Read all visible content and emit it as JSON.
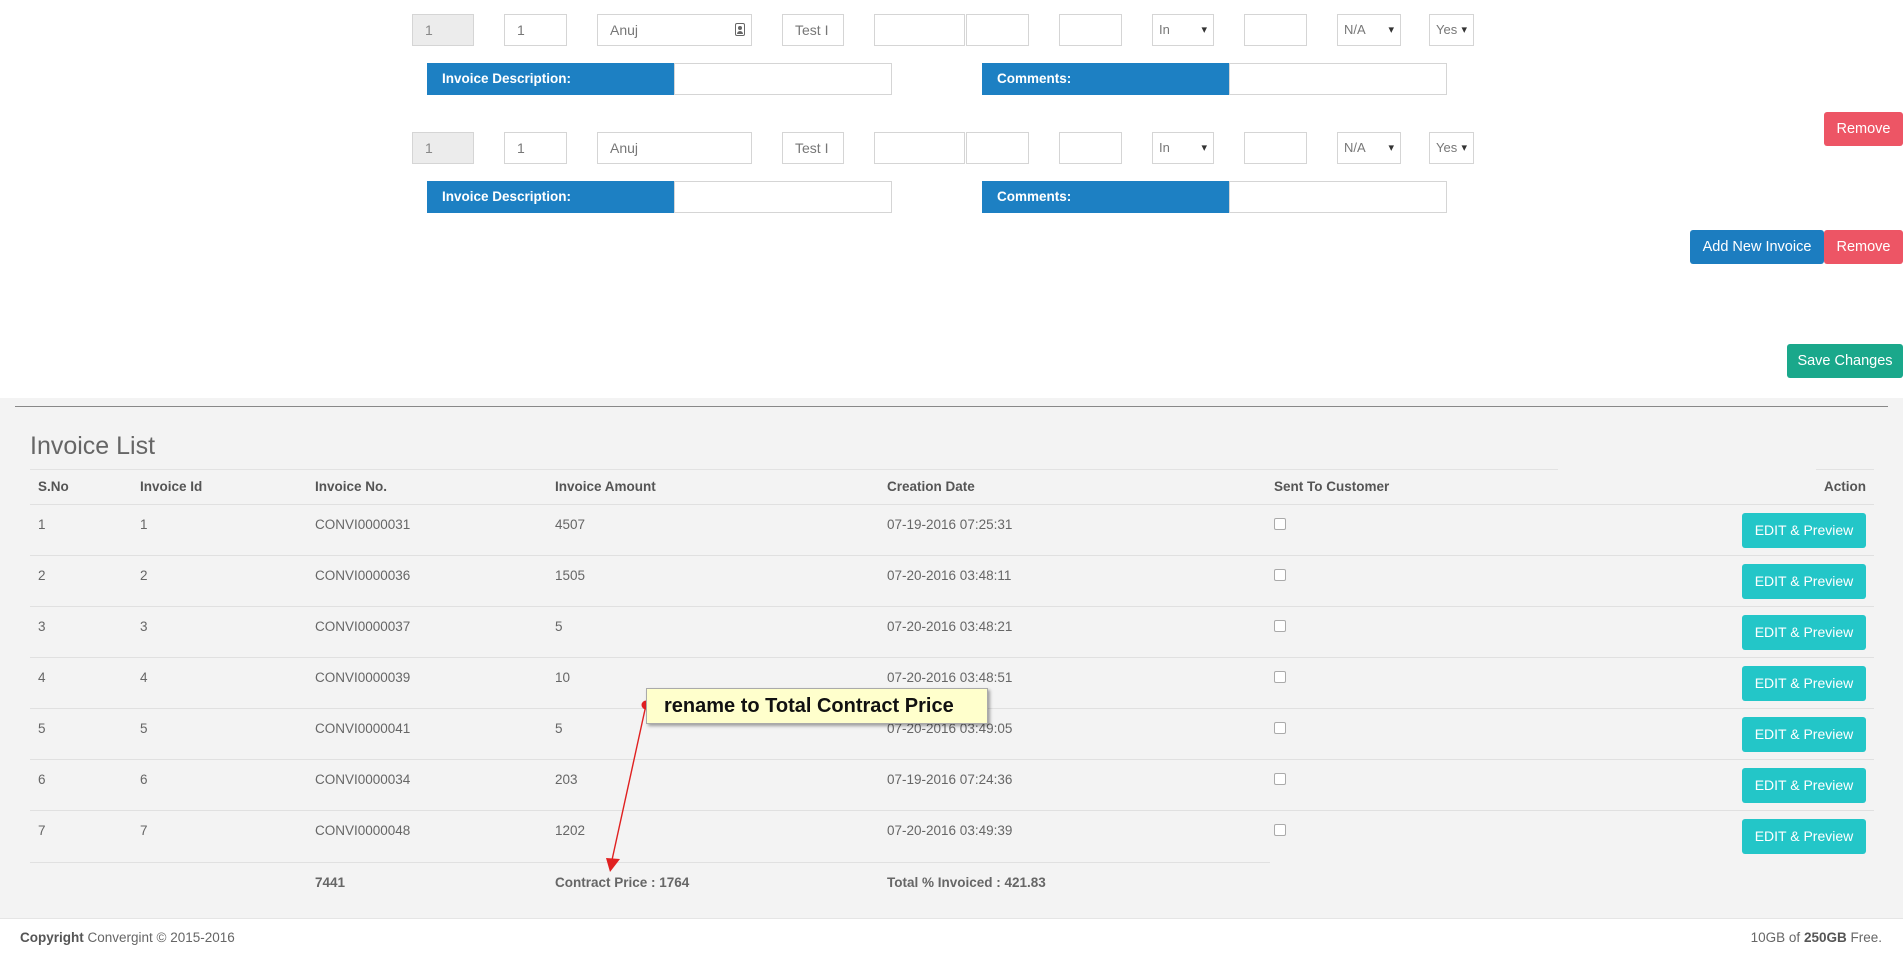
{
  "invoice_rows": [
    {
      "sno": "1",
      "id": "1",
      "contact": "Anuj",
      "title": "Test I",
      "amount": "",
      "qty": "",
      "price": "",
      "type": "In",
      "tax": "",
      "status": "N/A",
      "sent": "Yes",
      "description_label": "Invoice Description:",
      "comments_label": "Comments:"
    },
    {
      "sno": "1",
      "id": "1",
      "contact": "Anuj",
      "title": "Test I",
      "amount": "",
      "qty": "",
      "price": "",
      "type": "In",
      "tax": "",
      "status": "N/A",
      "sent": "Yes",
      "description_label": "Invoice Description:",
      "comments_label": "Comments:"
    }
  ],
  "buttons": {
    "remove": "Remove",
    "add_new_invoice": "Add New Invoice",
    "save_changes": "Save Changes",
    "edit_preview": "EDIT & Preview"
  },
  "invoice_list": {
    "title": "Invoice List",
    "columns": [
      "S.No",
      "Invoice Id",
      "Invoice No.",
      "Invoice Amount",
      "Creation Date",
      "Sent To Customer",
      "Action"
    ],
    "rows": [
      {
        "sno": "1",
        "id": "1",
        "no": "CONVI0000031",
        "amount": "4507",
        "date": "07-19-2016 07:25:31"
      },
      {
        "sno": "2",
        "id": "2",
        "no": "CONVI0000036",
        "amount": "1505",
        "date": "07-20-2016 03:48:11"
      },
      {
        "sno": "3",
        "id": "3",
        "no": "CONVI0000037",
        "amount": "5",
        "date": "07-20-2016 03:48:21"
      },
      {
        "sno": "4",
        "id": "4",
        "no": "CONVI0000039",
        "amount": "10",
        "date": "07-20-2016 03:48:51"
      },
      {
        "sno": "5",
        "id": "5",
        "no": "CONVI0000041",
        "amount": "5",
        "date": "07-20-2016 03:49:05"
      },
      {
        "sno": "6",
        "id": "6",
        "no": "CONVI0000034",
        "amount": "203",
        "date": "07-19-2016 07:24:36"
      },
      {
        "sno": "7",
        "id": "7",
        "no": "CONVI0000048",
        "amount": "1202",
        "date": "07-20-2016 03:49:39"
      }
    ],
    "totals": {
      "sum": "7441",
      "contract_price": "Contract Price : 1764",
      "total_invoiced": "Total % Invoiced : 421.83"
    }
  },
  "annotation": {
    "text": "rename to Total Contract Price",
    "color": "#e02020"
  },
  "footer": {
    "copyright_label": "Copyright",
    "copyright_text": "Convergint © 2015-2016",
    "storage_used": "10GB of",
    "storage_total": "250GB",
    "storage_suffix": "Free."
  },
  "colors": {
    "primary": "#1c7dc0",
    "danger": "#ed5565",
    "success": "#1aa88b",
    "info": "#23c6c8"
  }
}
